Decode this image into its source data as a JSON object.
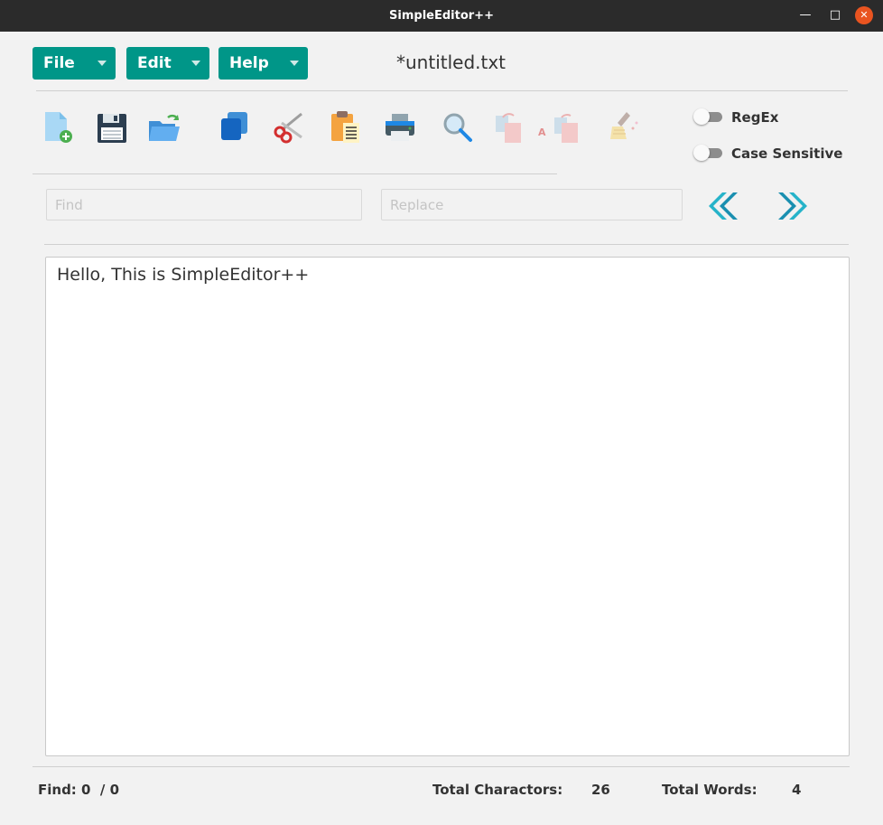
{
  "window": {
    "title": "SimpleEditor++",
    "minimize": "—",
    "maximize": "□",
    "close": "✕"
  },
  "menus": [
    {
      "label": "File"
    },
    {
      "label": "Edit"
    },
    {
      "label": "Help"
    }
  ],
  "document": {
    "filename": "*untitled.txt",
    "content": "Hello, This is SimpleEditor++"
  },
  "toolbar": {
    "icons": [
      "new-file-icon",
      "save-icon",
      "open-folder-icon",
      "copy-icon",
      "cut-icon",
      "paste-icon",
      "print-icon",
      "search-icon",
      "replace-icon",
      "replace-all-icon",
      "clear-icon"
    ]
  },
  "options": {
    "regex_label": "RegEx",
    "regex_on": false,
    "case_label": "Case Sensitive",
    "case_on": false
  },
  "search": {
    "find_placeholder": "Find",
    "replace_placeholder": "Replace",
    "find_value": "",
    "replace_value": ""
  },
  "status": {
    "find_label": "Find: 0  / 0",
    "chars_label": "Total Charactors:",
    "chars_value": "26",
    "words_label": "Total Words:",
    "words_value": "4"
  },
  "colors": {
    "menu": "#009688",
    "accent_nav": "#26b3c9",
    "titlebar": "#2b2b2b",
    "close": "#e95420"
  }
}
